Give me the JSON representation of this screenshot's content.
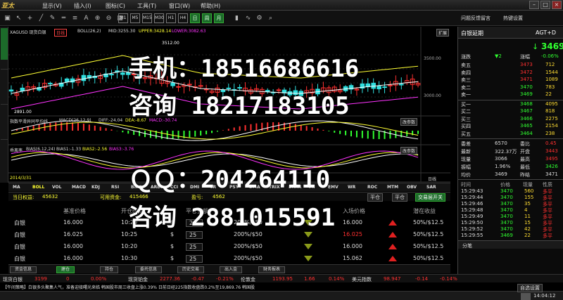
{
  "menu": {
    "logo": "亚太",
    "items": [
      "显示(V)",
      "插入(I)",
      "图标(C)",
      "工具(T)",
      "窗口(W)",
      "帮助(H)"
    ],
    "right": [
      "问题反馈留言",
      "热键设置"
    ]
  },
  "toolbar": {
    "periods": [
      "M1",
      "M5",
      "M15",
      "M30",
      "H1",
      "H4",
      "日",
      "周",
      "月"
    ]
  },
  "chart": {
    "symbol": "XAGUSD 现货白银",
    "tag": "日线",
    "boll": "BOLL(26,2)",
    "mid": "MID:3255.30",
    "upper": "UPPER:3428.14",
    "lower": "LOWER:3082.63",
    "price_top": "3500.00",
    "price_mid": "3000.00",
    "high_label": "3512.00",
    "low_label": "2891.00",
    "macd": "MACD(26,12,9)",
    "macd_title": "指数平滑异同平均线",
    "diff": "DIFF:-24.04",
    "dea": "DEA:-8.67",
    "macd_val": "MACD:-30.74",
    "bias_title": "乖离率",
    "bias": "BIAS(6,12,24)",
    "bias1": "BIAS1:-1.33",
    "bias2": "BIAS2:-2.56",
    "bias3": "BIAS3:-3.76",
    "change_btn": "改参数",
    "expand_btn": "扩展",
    "date": "2014/3/31",
    "tf": "日线"
  },
  "chart_data": {
    "type": "candlestick",
    "series": [
      {
        "name": "BOLL",
        "values": []
      }
    ]
  },
  "indicator_tabs": [
    "MA",
    "BOLL",
    "VOL",
    "MACD",
    "KDJ",
    "RSI",
    "BIAS",
    "ARBR",
    "CCI",
    "DMI",
    "CR",
    "PSY",
    "DMA",
    "TRIX",
    "BRAR",
    "VR",
    "EMV",
    "WR",
    "ROC",
    "MTM",
    "OBV",
    "SAR"
  ],
  "account": {
    "equity_label": "当日权益:",
    "equity": "45632",
    "avail_label": "可用资金:",
    "avail": "415466",
    "margin_label": "盈亏:",
    "margin": "4562",
    "buttons": [
      "平仓",
      "平仓",
      "交易层开关"
    ]
  },
  "orders": {
    "headers": [
      "",
      "基准价格",
      "开仓时间",
      "",
      "平仓金额",
      "",
      "",
      "入场价格",
      "",
      "潜在收益"
    ],
    "rows": [
      [
        "白银",
        "16.000",
        "10:20",
        "$",
        "25",
        "200%/$50",
        "",
        "16.000",
        "",
        "50%/$12.5"
      ],
      [
        "白银",
        "16.025",
        "10:25",
        "$",
        "25",
        "200%/$50",
        "",
        "16.025",
        "",
        "50%/$12.5"
      ],
      [
        "白银",
        "16.000",
        "10:20",
        "$",
        "25",
        "200%/$50",
        "",
        "16.000",
        "",
        "50%/$12.5"
      ],
      [
        "白银",
        "16.000",
        "10:30",
        "$",
        "25",
        "200%/$50",
        "",
        "15.062",
        "",
        "50%/$12.5"
      ]
    ]
  },
  "bottom_tabs": [
    "资金信息",
    "建仓",
    "持仓",
    "委托信息",
    "历史交易",
    "出入金",
    "财务报表"
  ],
  "ticker": [
    {
      "name": "现货白银",
      "v1": "3199",
      "v2": "0",
      "v3": "0.00%"
    },
    {
      "name": "现货铂金",
      "v1": "2277.36",
      "v2": "-0.47",
      "v3": "-0.21%"
    },
    {
      "name": "伦敦金",
      "v1": "1193.95",
      "v2": "1.66",
      "v3": "0.14%"
    },
    {
      "name": "美元指数",
      "v1": "98.947",
      "v2": "-0.14",
      "v3": "-0.14%"
    }
  ],
  "news": "【午间策略】白银多头聚集人气，准备迎接曙光来临 韩国股市周三收盘上涨0.39% 日前日经225指数收盘跌0.2%至19,869.76 韩国股",
  "status": {
    "setup": "自选设置",
    "time": "14:04:12"
  },
  "panel": {
    "title": "白银延期",
    "code": "AGT+D",
    "price": "3469",
    "change_label": "涨跌",
    "change_arrow": "▼2",
    "pct_label": "涨幅",
    "pct": "-0.06%",
    "asks": [
      [
        "卖五",
        "3473",
        "712"
      ],
      [
        "卖四",
        "3472",
        "1544"
      ],
      [
        "卖三",
        "3471",
        "1089"
      ],
      [
        "卖二",
        "3470",
        "783"
      ],
      [
        "卖一",
        "3469",
        "22"
      ]
    ],
    "bids": [
      [
        "买一",
        "3468",
        "4095"
      ],
      [
        "买二",
        "3467",
        "818"
      ],
      [
        "买三",
        "3466",
        "2275"
      ],
      [
        "买四",
        "3465",
        "2154"
      ],
      [
        "买五",
        "3464",
        "238"
      ]
    ],
    "stats": [
      [
        "委差",
        "6570",
        "委比",
        "0.45"
      ],
      [
        "最新",
        "322.37万",
        "开盘",
        "3443"
      ],
      [
        "现量",
        "3066",
        "最高",
        "3495"
      ],
      [
        "振幅",
        "1.96%",
        "最低",
        "3426"
      ],
      [
        "均价",
        "3469",
        "昨结",
        "3471"
      ]
    ],
    "trade_headers": [
      "时间",
      "价格",
      "现量",
      "性质"
    ],
    "trades": [
      [
        "15:29:43",
        "3470",
        "560",
        "多平"
      ],
      [
        "15:29:44",
        "3470",
        "155",
        "多平"
      ],
      [
        "15:29:46",
        "3470",
        "35",
        "多平"
      ],
      [
        "15:29:48",
        "3470",
        "4",
        "多平"
      ],
      [
        "15:29:49",
        "3470",
        "11",
        "多平"
      ],
      [
        "15:29:50",
        "3470",
        "15",
        "多平"
      ],
      [
        "15:29:52",
        "3470",
        "42",
        "多平"
      ],
      [
        "15:29:55",
        "3469",
        "22",
        "多平"
      ]
    ],
    "tabs": [
      "分笔",
      "",
      "",
      ""
    ]
  },
  "watermark": {
    "l1": "手机：18516686616",
    "l2": "咨询  18217183105",
    "l3": "ＱＱ：204264110",
    "l4": "咨询  2881015591"
  }
}
